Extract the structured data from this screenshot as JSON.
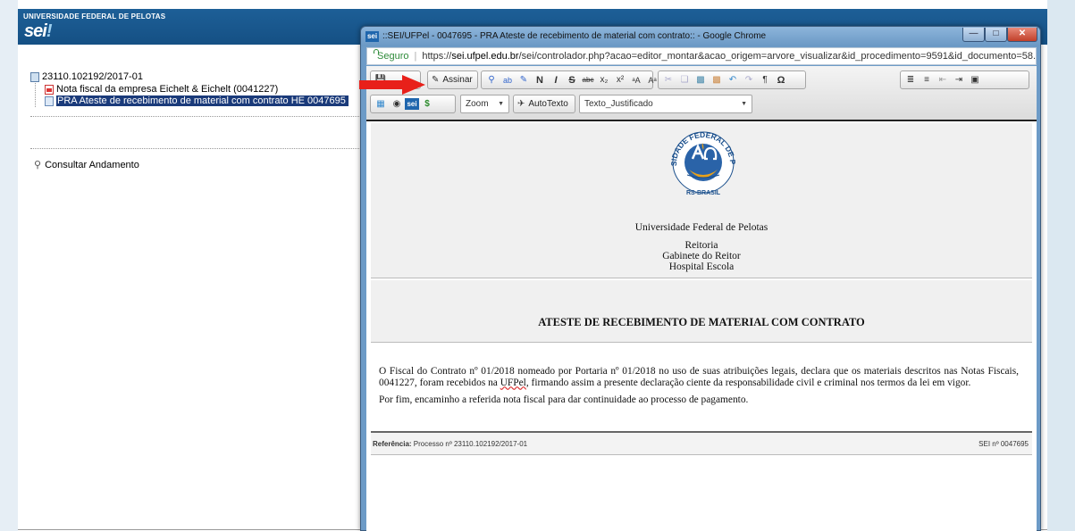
{
  "app": {
    "university_name": "UNIVERSIDADE FEDERAL DE PELOTAS",
    "logo_text": "sei",
    "logo_accent": "!"
  },
  "tree": {
    "process_number": "23110.102192/2017-01",
    "items": [
      {
        "label": "Nota fiscal da empresa Eichelt & Eichelt (0041227)",
        "icon": "pdf-icon"
      },
      {
        "label": "PRA Ateste de recebimento de material com contrato HE 0047695",
        "icon": "document-icon",
        "selected": true
      }
    ],
    "consultar_label": "Consultar Andamento"
  },
  "popup": {
    "window_title": "::SEI/UFPel - 0047695 - PRA Ateste de recebimento de material com contrato:: - Google Chrome",
    "favicon_text": "sei",
    "address": {
      "secure_label": "Seguro",
      "url_scheme": "https://",
      "url_host": "sei.ufpel.edu.br",
      "url_path": "/sei/controlador.php?acao=editor_montar&acao_origem=arvore_visualizar&id_procedimento=9591&id_documento=58..."
    }
  },
  "toolbar": {
    "assinar_label": "Assinar",
    "zoom_label": "Zoom",
    "autotexto_label": "AutoTexto",
    "style_value": "Texto_Justificado"
  },
  "document": {
    "seal_top_text": "UNIVERSIDADE FEDERAL DE PELOTAS",
    "seal_bottom_text": "RS-BRASIL",
    "institution": "Universidade Federal de Pelotas",
    "dept_line1": "Reitoria",
    "dept_line2": "Gabinete do Reitor",
    "dept_line3": "Hospital Escola",
    "title": "ATESTE DE RECEBIMENTO DE MATERIAL COM CONTRATO",
    "paragraph1_part1": "O Fiscal do Contrato nº 01/2018 nomeado por Portaria nº 01/2018 no uso de suas atribuições legais, declara que os materiais descritos nas Notas Fiscais, 0041227, foram recebidos na ",
    "paragraph1_ufpel": "UFPel",
    "paragraph1_part2": ", firmando  assim a presente declaração ciente da responsabilidade civil e criminal nos termos da lei em vigor.",
    "paragraph2": "Por fim, encaminho a referida nota fiscal para dar continuidade ao processo de pagamento.",
    "ref_label": "Referência:",
    "ref_value": " Processo nº 23110.102192/2017-01",
    "sei_number": "SEI nº 0047695"
  },
  "colors": {
    "header_blue": "#1d5f97",
    "selected_row": "#1a3a7a",
    "arrow_red": "#e8201a",
    "secure_green": "#2e8b3a"
  }
}
